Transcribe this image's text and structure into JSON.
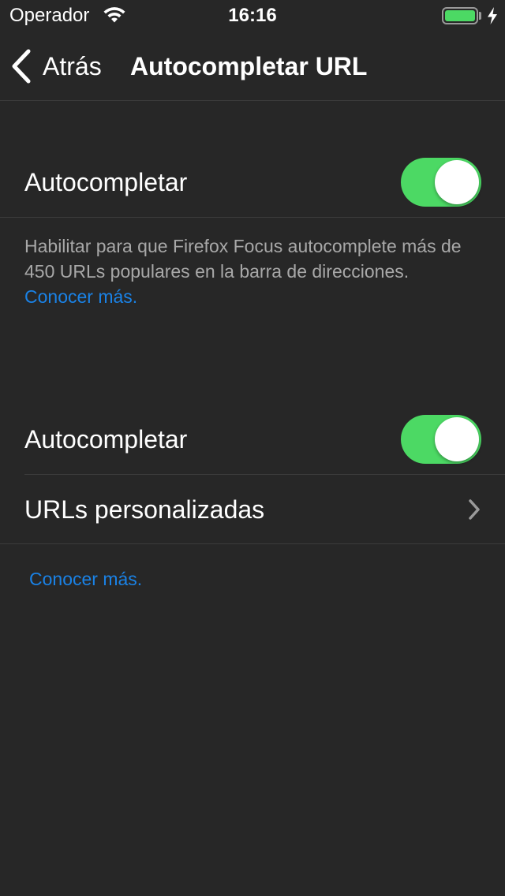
{
  "status_bar": {
    "carrier": "Operador",
    "time": "16:16",
    "battery_level": 1.0,
    "charging": true
  },
  "nav": {
    "back_label": "Atrás",
    "title": "Autocompletar URL"
  },
  "section1": {
    "toggle_label": "Autocompletar",
    "toggle_on": true,
    "description": "Habilitar para que Firefox Focus autocomplete más de 450 URLs populares en la barra de direcciones.",
    "learn_more": "Conocer más."
  },
  "section2": {
    "toggle_label": "Autocompletar",
    "toggle_on": true,
    "custom_urls_label": "URLs personalizadas",
    "learn_more": "Conocer más."
  },
  "colors": {
    "background": "#272727",
    "toggle_on": "#4cd964",
    "link": "#1a82e6",
    "secondary_text": "#a8a8a8"
  },
  "icons": {
    "wifi": "wifi-icon",
    "battery": "battery-icon",
    "charging": "charging-bolt-icon",
    "back": "chevron-left-icon",
    "disclosure": "chevron-right-icon"
  }
}
